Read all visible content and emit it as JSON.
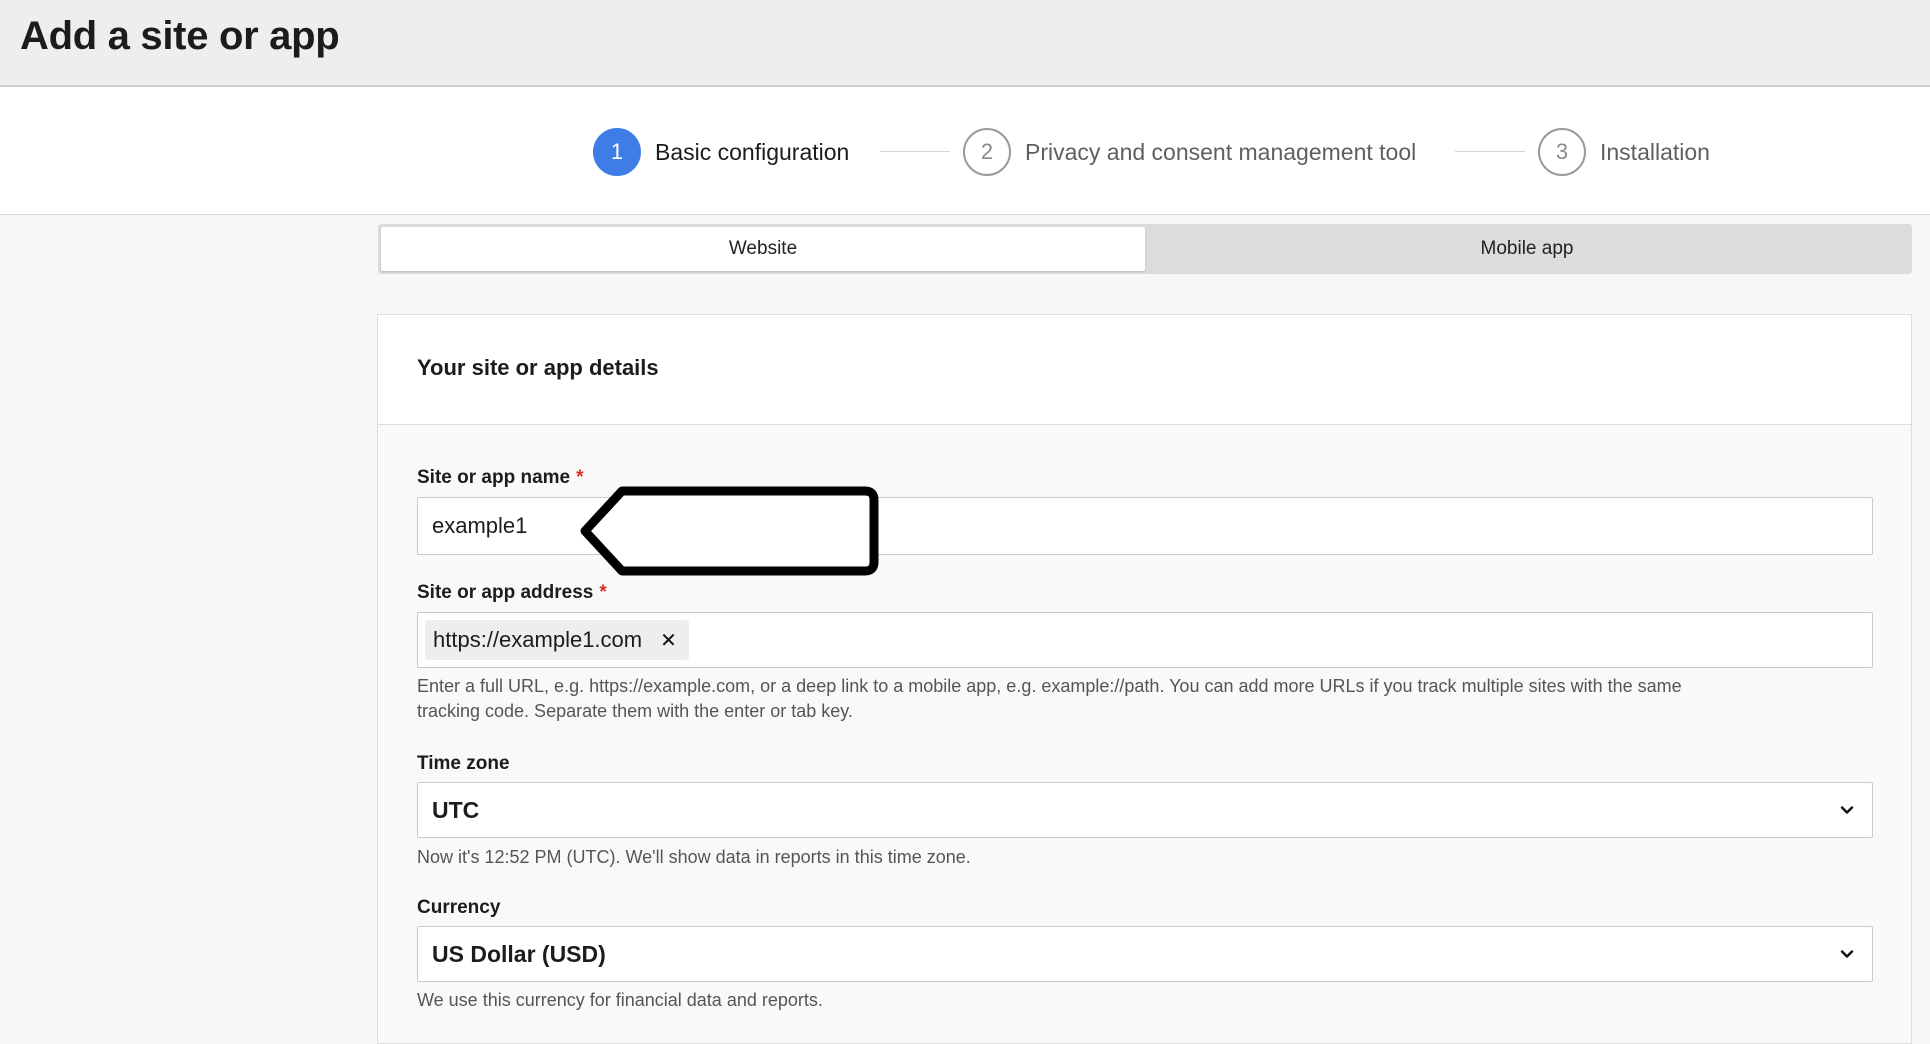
{
  "header": {
    "title": "Add a site or app"
  },
  "stepper": {
    "steps": [
      {
        "number": "1",
        "label": "Basic configuration"
      },
      {
        "number": "2",
        "label": "Privacy and consent management tool"
      },
      {
        "number": "3",
        "label": "Installation"
      }
    ],
    "active_step": 1,
    "active_color": "#3e7de6"
  },
  "type_toggle": {
    "options": [
      "Website",
      "Mobile app"
    ],
    "selected": "Website"
  },
  "details_card": {
    "title": "Your site or app details",
    "name_field": {
      "label": "Site or app name",
      "required_mark": "*",
      "value": "example1"
    },
    "address_field": {
      "label": "Site or app address",
      "required_mark": "*",
      "chips": [
        "https://example1.com"
      ],
      "remove_glyph": "✕",
      "help_line1": "Enter a full URL, e.g. https://example.com, or a deep link to a mobile app, e.g. example://path. You can add more URLs if you track multiple sites with the same",
      "help_line2": "tracking code. Separate them with the enter or tab key."
    },
    "timezone_field": {
      "label": "Time zone",
      "value": "UTC",
      "help": "Now it's 12:52 PM (UTC). We'll show data in reports in this time zone."
    },
    "currency_field": {
      "label": "Currency",
      "value": "US Dollar (USD)",
      "help": "We use this currency for financial data and reports."
    }
  },
  "icons": {
    "select_chevron": "chevron-down-icon",
    "chip_remove": "close-icon"
  }
}
